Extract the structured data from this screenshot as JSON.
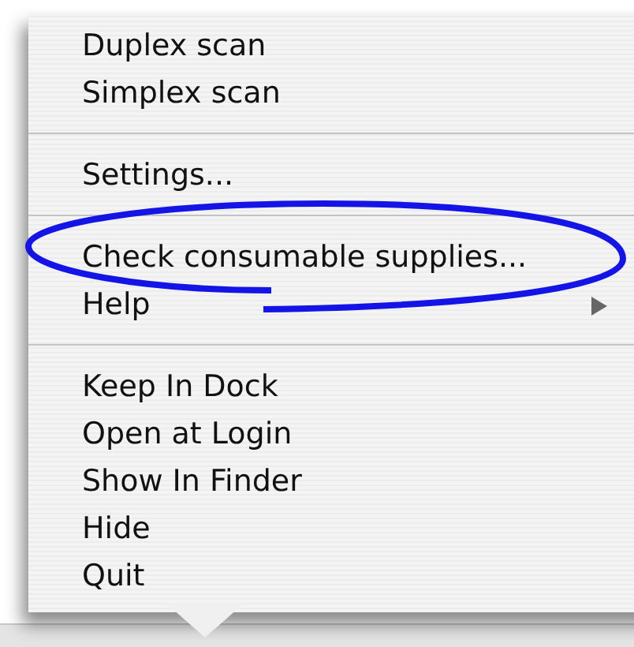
{
  "menu": {
    "groups": [
      {
        "items": [
          {
            "label": "Duplex scan",
            "has_submenu": false,
            "circled": false
          },
          {
            "label": "Simplex scan",
            "has_submenu": false,
            "circled": false
          }
        ]
      },
      {
        "items": [
          {
            "label": "Settings...",
            "has_submenu": false,
            "circled": false
          }
        ]
      },
      {
        "items": [
          {
            "label": "Check consumable supplies...",
            "has_submenu": false,
            "circled": true
          },
          {
            "label": "Help",
            "has_submenu": true,
            "circled": false
          }
        ]
      },
      {
        "items": [
          {
            "label": "Keep In Dock",
            "has_submenu": false,
            "circled": false
          },
          {
            "label": "Open at Login",
            "has_submenu": false,
            "circled": false
          },
          {
            "label": "Show In Finder",
            "has_submenu": false,
            "circled": false
          },
          {
            "label": "Hide",
            "has_submenu": false,
            "circled": false
          },
          {
            "label": "Quit",
            "has_submenu": false,
            "circled": false
          }
        ]
      }
    ]
  }
}
